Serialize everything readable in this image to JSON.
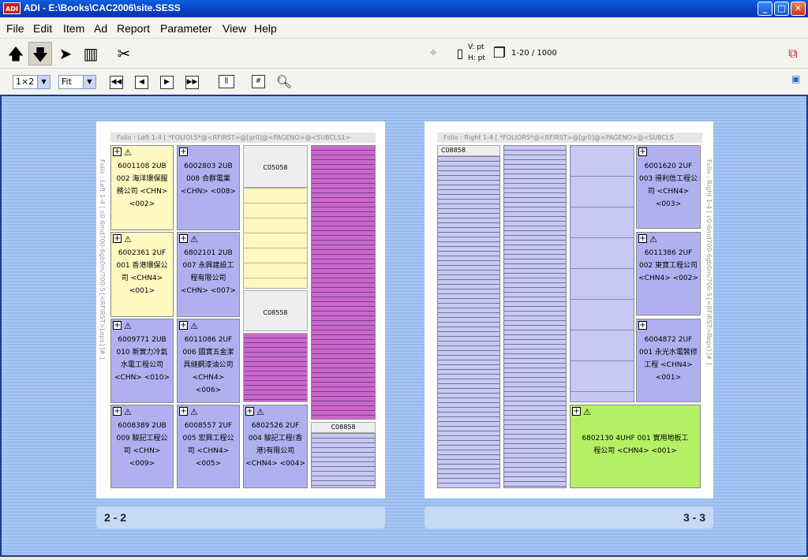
{
  "window": {
    "title": "ADI - E:\\Books\\CAC2006\\site.SESS",
    "app_icon": "ADI"
  },
  "menu": [
    "File",
    "Edit",
    "Item",
    "Ad",
    "Report",
    "Parameter",
    "View",
    "Help"
  ],
  "toolbar": {
    "v_unit": "V: pt",
    "h_unit": "H: pt",
    "page_range": "1-20 / 1000",
    "layout_value": "1×2",
    "zoom_value": "Fit"
  },
  "left_page": {
    "header": "Folio : Left 1-4 [ *FOLIOLS*@<RFIRST>@[gr0]@<PAGENO>@<SUBCLS1>",
    "side_label": "Folio : Left 1-4 [ c0-6md700-6gb0m/700-5{<RFIRST>Leps}]#.]",
    "footer": "2 - 2",
    "ads": [
      "6001108 2UB 002 海洋環保服務公司 <CHN> <002>",
      "6002803 2UB 008 合群電業 <CHN> <008>",
      "6002361 2UF 001 香港環保公司 <CHN4> <001>",
      "6802101 2UB 007 永興建設工程有限公司 <CHN> <007>",
      "6009771 2UB 010 新實力冷氣水電工程公司 <CHN> <010>",
      "6011086 2UF 006 國寶五金潔具縫鋼漆油公司 <CHN4> <006>",
      "6008389 2UB 009 駿記工程公司 <CHN> <009>",
      "6008557 2UF 005 宏興工程公司 <CHN4> <005>",
      "6802526 2UF 004 駿記工程(香港)有限公司 <CHN4> <004>"
    ],
    "ids": [
      "C05058",
      "C08558",
      "C08858"
    ]
  },
  "right_page": {
    "header": "Folio : Right 1-4 [ *FOLIORS*@<RFIRST>@[gr0]@<PAGENO>@<SUBCLS",
    "side_label": "Folio : Right 1-4 [ c0-6md700-6gb0m/700-5{<RFIRST>Reps}]#.]",
    "footer": "3 - 3",
    "ads": [
      "6001620 2UF 003 得利信工程公司 <CHN4> <003>",
      "6011386 2UF 002 東寶工程公司 <CHN4> <002>",
      "6004872 2UF 001 永光水電裝修工程 <CHN4> <001>",
      "6802130 4UHF 001 實用地板工程公司 <CHN4> <001>"
    ],
    "ids": [
      "C08858"
    ]
  },
  "colors": {
    "yellow": "#fff8c0",
    "lavender": "#b0b0f0",
    "magenta": "#cc66cc",
    "green": "#b4f064"
  }
}
